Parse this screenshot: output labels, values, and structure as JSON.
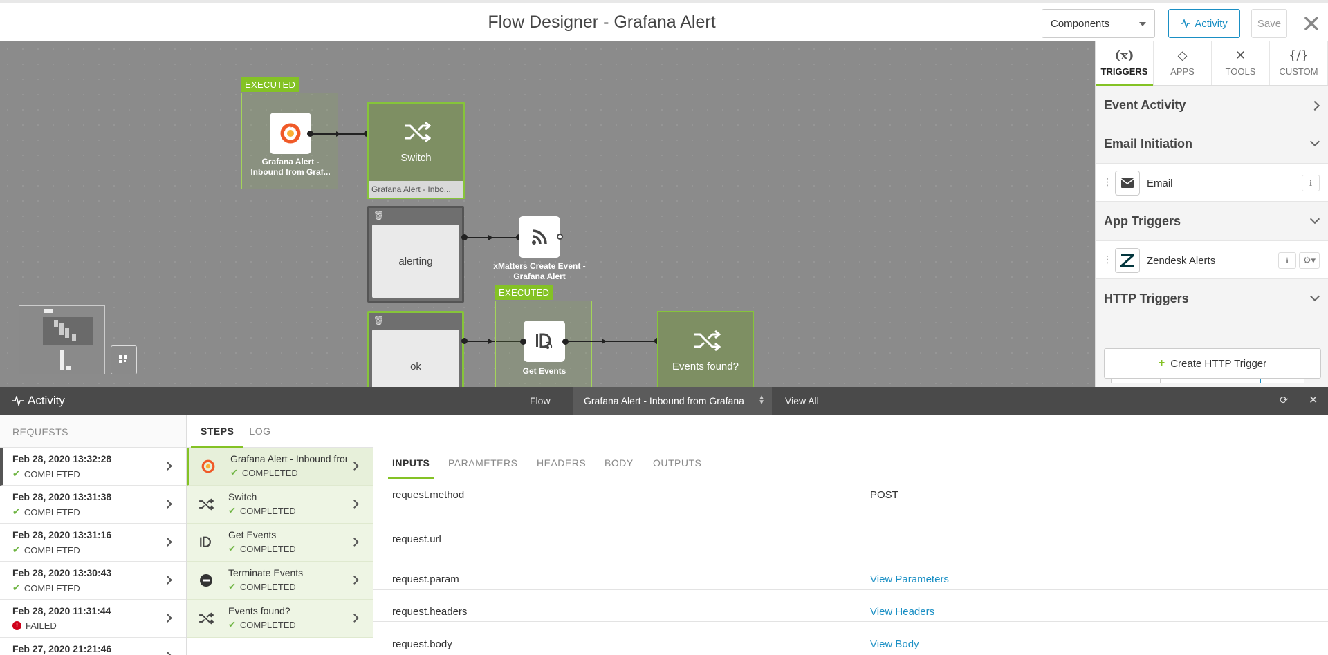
{
  "header": {
    "title": "Flow Designer - Grafana Alert",
    "components_select": "Components",
    "activity_button": "Activity",
    "save_button": "Save"
  },
  "canvas": {
    "executed_tag_1": "EXECUTED",
    "executed_tag_2": "EXECUTED",
    "grafana_node_label": "Grafana Alert - Inbound from Graf...",
    "switch_label": "Switch",
    "switch_sub": "Grafana Alert - Inbo...",
    "branch_alerting": "alerting",
    "branch_ok": "ok",
    "xmatters_label": "xMatters Create Event - Grafana Alert",
    "get_events_label": "Get Events",
    "events_found_label": "Events found?"
  },
  "panel": {
    "tabs": [
      {
        "icon": "(x)",
        "label": "TRIGGERS"
      },
      {
        "icon": "◇",
        "label": "APPS"
      },
      {
        "icon": "✕",
        "label": "TOOLS"
      },
      {
        "icon": "{/}",
        "label": "CUSTOM"
      }
    ],
    "sections": {
      "event_activity": "Event Activity",
      "email_initiation": "Email Initiation",
      "email_item": "Email",
      "app_triggers": "App Triggers",
      "zendesk_item": "Zendesk Alerts",
      "http_triggers": "HTTP Triggers"
    },
    "create_http": "Create HTTP Trigger"
  },
  "activity": {
    "title": "Activity",
    "flow": "Flow",
    "selected": "Grafana Alert - Inbound from Grafana",
    "view_all": "View All"
  },
  "requests": {
    "header": "REQUESTS",
    "items": [
      {
        "date": "Feb 28, 2020 13:32:28",
        "status": "COMPLETED"
      },
      {
        "date": "Feb 28, 2020 13:31:38",
        "status": "COMPLETED"
      },
      {
        "date": "Feb 28, 2020 13:31:16",
        "status": "COMPLETED"
      },
      {
        "date": "Feb 28, 2020 13:30:43",
        "status": "COMPLETED"
      },
      {
        "date": "Feb 28, 2020 11:31:44",
        "status": "FAILED"
      },
      {
        "date": "Feb 27, 2020 21:21:46",
        "status": ""
      }
    ]
  },
  "steps": {
    "tabs": [
      "STEPS",
      "LOG"
    ],
    "items": [
      {
        "name": "Grafana Alert - Inbound from Grafana",
        "status": "COMPLETED"
      },
      {
        "name": "Switch",
        "status": "COMPLETED"
      },
      {
        "name": "Get Events",
        "status": "COMPLETED"
      },
      {
        "name": "Terminate Events",
        "status": "COMPLETED"
      },
      {
        "name": "Events found?",
        "status": "COMPLETED"
      }
    ]
  },
  "detail": {
    "tabs": [
      "INPUTS",
      "PARAMETERS",
      "HEADERS",
      "BODY",
      "OUTPUTS"
    ],
    "rows": [
      {
        "key": "request.method",
        "value": "POST"
      },
      {
        "key": "request.url",
        "value": ""
      },
      {
        "key": "request.param",
        "value": "View Parameters"
      },
      {
        "key": "request.headers",
        "value": "View Headers"
      },
      {
        "key": "request.body",
        "value": "View Body"
      }
    ]
  },
  "colors": {
    "accent_green": "#84c225",
    "link_blue": "#1a8fc4",
    "failed_red": "#d0021b"
  }
}
